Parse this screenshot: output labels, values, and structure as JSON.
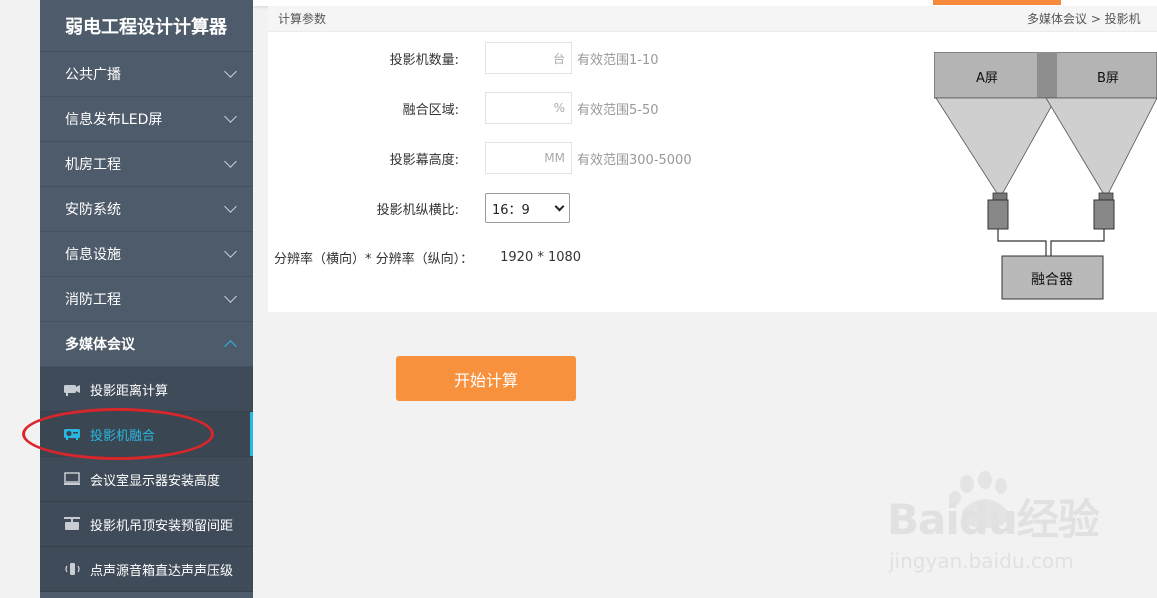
{
  "sidebar": {
    "title": "弱电工程设计计算器",
    "categories": [
      {
        "label": "公共广播"
      },
      {
        "label": "信息发布LED屏"
      },
      {
        "label": "机房工程"
      },
      {
        "label": "安防系统"
      },
      {
        "label": "信息设施"
      },
      {
        "label": "消防工程"
      },
      {
        "label": "多媒体会议"
      }
    ],
    "sub_items": [
      {
        "label": "投影距离计算",
        "icon": "projector-camera-icon"
      },
      {
        "label": "投影机融合",
        "icon": "projector-icon"
      },
      {
        "label": "会议室显示器安装高度",
        "icon": "monitor-icon"
      },
      {
        "label": "投影机吊顶安装预留间距",
        "icon": "ceiling-projector-icon"
      },
      {
        "label": "点声源音箱直达声声压级",
        "icon": "speaker-icon"
      }
    ],
    "active_sub_item": "投影机融合"
  },
  "panel": {
    "header_title": "计算参数",
    "breadcrumb": "多媒体会议 > 投影机"
  },
  "form": {
    "projector_count": {
      "label": "投影机数量:",
      "unit": "台",
      "hint": "有效范围1-10"
    },
    "blend_area": {
      "label": "融合区域:",
      "unit": "%",
      "hint": "有效范围5-50"
    },
    "screen_height": {
      "label": "投影幕高度:",
      "unit": "MM",
      "hint": "有效范围300-5000"
    },
    "aspect_ratio": {
      "label": "投影机纵横比:",
      "value": "16：9"
    },
    "resolution": {
      "label": "分辨率（横向）* 分辨率（纵向）：",
      "value": "1920 * 1080"
    }
  },
  "diagram": {
    "screen_a": "A屏",
    "screen_b": "B屏",
    "blender": "融合器"
  },
  "actions": {
    "calculate": "开始计算"
  },
  "watermark": {
    "brand_logo": "Baidu经验",
    "url": "jingyan.baidu.com"
  },
  "colors": {
    "sidebar_bg": "#4e5b6a",
    "accent_blue": "#28b8e2",
    "button_orange": "#f7913d",
    "annotation_red": "#d8262a"
  }
}
